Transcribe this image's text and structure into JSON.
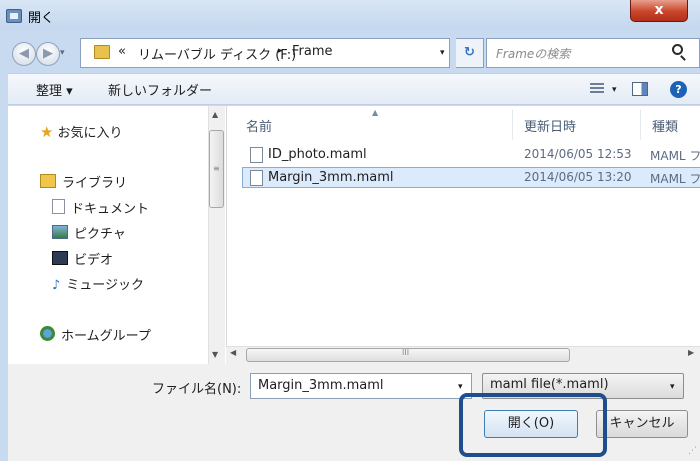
{
  "window": {
    "title": "開く",
    "close_label": "x"
  },
  "address": {
    "chevron": "«",
    "segment1": "リムーバブル ディスク (F:)",
    "separator": "▸",
    "segment2": "Frame",
    "dropdown": "▾",
    "refresh": "↻"
  },
  "search": {
    "placeholder": "Frameの検索"
  },
  "toolbar": {
    "organize_label": "整理 ▾",
    "new_folder_label": "新しいフォルダー",
    "view_dropdown": "▾",
    "help_label": "?"
  },
  "nav": {
    "favorites": "お気に入り",
    "libraries": "ライブラリ",
    "documents": "ドキュメント",
    "pictures": "ピクチャ",
    "videos": "ビデオ",
    "music": "ミュージック",
    "homegroup": "ホームグループ"
  },
  "columns": {
    "name": "名前",
    "date": "更新日時",
    "type": "種類"
  },
  "files": [
    {
      "name": "ID_photo.maml",
      "date": "2014/06/05 12:53",
      "type": "MAML フ"
    },
    {
      "name": "Margin_3mm.maml",
      "date": "2014/06/05 13:20",
      "type": "MAML フ"
    }
  ],
  "scroll": {
    "up": "▲",
    "down": "▼",
    "left": "◀",
    "right": "▶",
    "grip_v": "≡",
    "grip_h": "III"
  },
  "bottom": {
    "filename_label": "ファイル名(N):",
    "filename_value": "Margin_3mm.maml",
    "filter_value": "maml file(*.maml)",
    "open_label": "開く(O)",
    "cancel_label": "キャンセル",
    "dropdown": "▾"
  },
  "colors": {
    "selection": "#dcebfc",
    "highlight_border": "#1e4f8c",
    "titlebar": "#c4d7ee"
  }
}
